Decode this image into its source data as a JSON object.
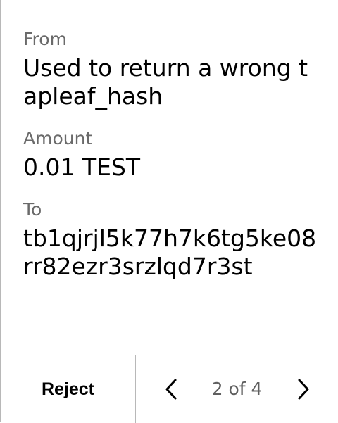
{
  "transaction": {
    "from_label": "From",
    "from_value": "Used to return a wrong tapleaf_hash",
    "amount_label": "Amount",
    "amount_value": "0.01 TEST",
    "to_label": "To",
    "to_value": "tb1qjrjl5k77h7k6tg5ke08rr82ezr3srzlqd7r3st"
  },
  "footer": {
    "reject_label": "Reject",
    "pager_text": "2 of 4",
    "prev_icon": "chevron-left-icon",
    "next_icon": "chevron-right-icon"
  },
  "colors": {
    "label_gray": "#6a6a6a",
    "divider": "#b8b8b8",
    "pager_gray": "#5f5f5f",
    "text": "#000000",
    "background": "#ffffff"
  }
}
